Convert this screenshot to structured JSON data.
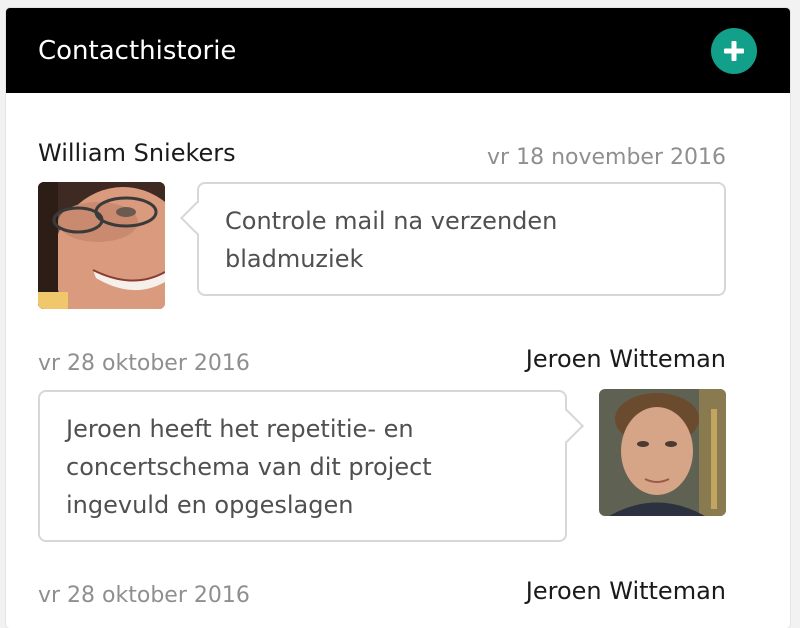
{
  "header": {
    "title": "Contacthistorie",
    "add_icon": "plus-icon",
    "accent_color": "#12a08a"
  },
  "entries": [
    {
      "name": "William Sniekers",
      "date": "vr 18 november 2016",
      "message": "Controle mail na verzenden bladmuziek",
      "avatar_side": "left"
    },
    {
      "name": "Jeroen Witteman",
      "date": "vr 28 oktober 2016",
      "message": "Jeroen heeft het repetitie- en concertschema van dit project ingevuld en opgeslagen",
      "avatar_side": "right"
    },
    {
      "name": "Jeroen Witteman",
      "date": "vr 28 oktober 2016"
    }
  ]
}
